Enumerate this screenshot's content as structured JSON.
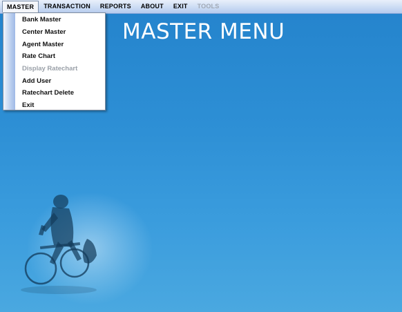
{
  "menubar": {
    "items": [
      {
        "label": "MASTER",
        "state": "open"
      },
      {
        "label": "TRANSACTION",
        "state": "enabled"
      },
      {
        "label": "REPORTS",
        "state": "enabled"
      },
      {
        "label": "ABOUT",
        "state": "enabled"
      },
      {
        "label": "EXIT",
        "state": "enabled"
      },
      {
        "label": "TOOLS",
        "state": "disabled"
      }
    ]
  },
  "master_menu": {
    "options": [
      {
        "label": "Bank Master",
        "enabled": true
      },
      {
        "label": "Center Master",
        "enabled": true
      },
      {
        "label": "Agent Master",
        "enabled": true
      },
      {
        "label": "Rate Chart",
        "enabled": true
      },
      {
        "label": "Display Ratechart",
        "enabled": false
      },
      {
        "label": "Add User",
        "enabled": true
      },
      {
        "label": "Ratechart Delete",
        "enabled": true
      },
      {
        "label": "Exit",
        "enabled": true
      }
    ]
  },
  "main": {
    "heading": "MASTER MENU"
  },
  "colors": {
    "background": "#2d8fd5",
    "menubar": "#c9daf3",
    "heading_text": "#ffffff",
    "disabled_text": "#9aa0a8"
  }
}
